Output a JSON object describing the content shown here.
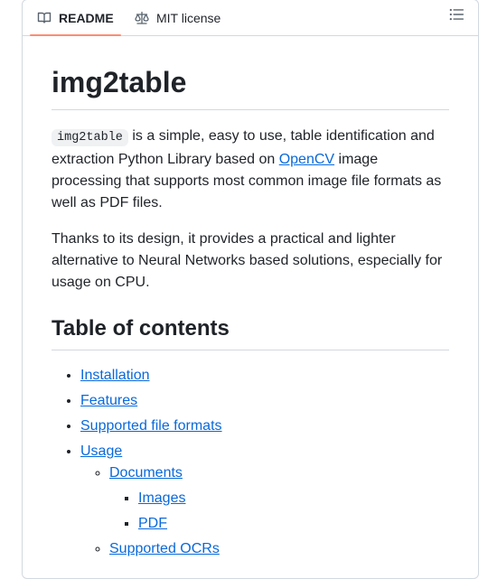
{
  "tabs": {
    "readme": "README",
    "license": "MIT license"
  },
  "readme": {
    "title": "img2table",
    "intro": {
      "code": "img2table",
      "text_before_link": " is a simple, easy to use, table identification and extraction Python Library based on ",
      "link": "OpenCV",
      "text_after_link": " image processing that supports most common image file formats as well as PDF files."
    },
    "para2": "Thanks to its design, it provides a practical and lighter alternative to Neural Networks based solutions, especially for usage on CPU.",
    "toc_heading": "Table of contents",
    "toc": {
      "installation": "Installation",
      "features": "Features",
      "supported_formats": "Supported file formats",
      "usage": "Usage",
      "documents": "Documents",
      "images": "Images",
      "pdf": "PDF",
      "supported_ocrs": "Supported OCRs"
    }
  },
  "colors": {
    "link": "#0969da",
    "tab_underline": "#fd8c73",
    "border": "#d1d9e0"
  },
  "icons": {
    "readme": "book-icon",
    "license": "law-scale-icon",
    "toc": "list-unordered-icon"
  }
}
